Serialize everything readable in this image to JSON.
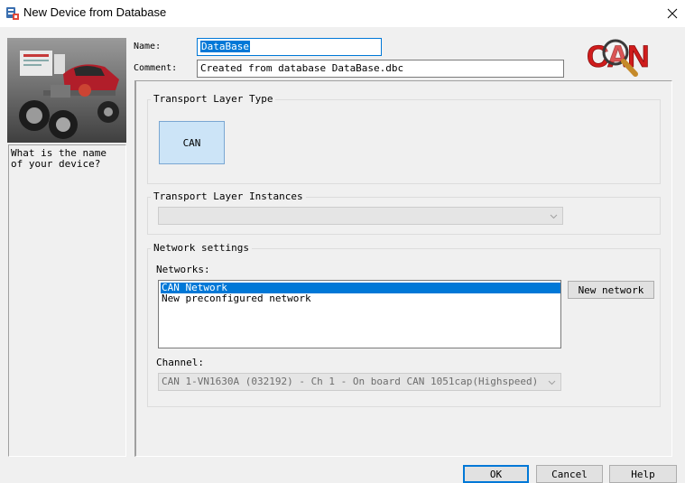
{
  "window": {
    "title": "New Device from Database",
    "app_icon": "database-device-icon",
    "close_icon": "close-icon"
  },
  "left_panel": {
    "illustration": "car-chassis-illustration",
    "help_text": "What is the name of your device?"
  },
  "fields": {
    "name_label": "Name:",
    "name_value": "DataBase",
    "comment_label": "Comment:",
    "comment_value": "Created from database DataBase.dbc"
  },
  "logo": {
    "text": "CAN",
    "color": "#d01c1c",
    "icon": "can-logo-magnifier-icon"
  },
  "transport_layer_type": {
    "title": "Transport Layer Type",
    "option": "CAN"
  },
  "transport_layer_instances": {
    "title": "Transport Layer Instances",
    "selected": ""
  },
  "network_settings": {
    "title": "Network settings",
    "networks_label": "Networks:",
    "networks": [
      "CAN Network",
      "New preconfigured network"
    ],
    "selected_index": 0,
    "new_network_button": "New network",
    "channel_label": "Channel:",
    "channel_value": "CAN 1-VN1630A (032192) - Ch 1 - On board CAN 1051cap(Highspeed)"
  },
  "buttons": {
    "ok": "OK",
    "cancel": "Cancel",
    "help": "Help"
  },
  "colors": {
    "accent": "#0078d7",
    "selected_tile": "#cce4f7",
    "window_bg": "#f0f0f0"
  }
}
